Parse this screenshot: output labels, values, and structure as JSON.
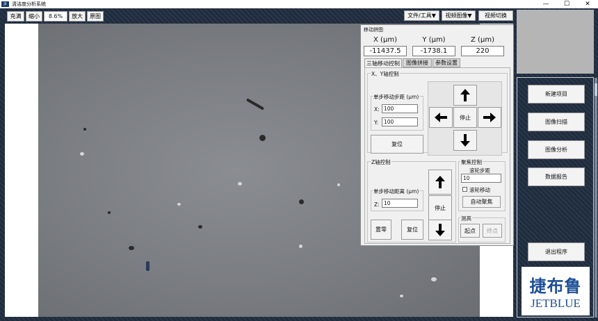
{
  "window": {
    "title": "清洁度分析系统",
    "icon": "app-logo-icon",
    "minimize": "—",
    "maximize": "☐",
    "close": "✕"
  },
  "toolbar": {
    "fit": "充满",
    "zoom_out": "缩小",
    "zoom_value": "8.6%",
    "zoom_in": "放大",
    "original": "原图",
    "file_tools": "文件/工具▼",
    "video_image": "视频图像▼",
    "video_switch": "视频切换"
  },
  "dialog": {
    "title": "移动拼图",
    "axes": [
      {
        "label": "X (μm)",
        "value": "-11437.5"
      },
      {
        "label": "Y (μm)",
        "value": "-1738.1"
      },
      {
        "label": "Z (μm)",
        "value": "220"
      }
    ],
    "tabs": [
      "三轴移动控制",
      "图像拼接",
      "参数设置"
    ],
    "xy": {
      "group": "X、Y轴控制",
      "step_group": "单步移动步距 (μm)",
      "x_label": "X:",
      "x_value": "100",
      "y_label": "Y:",
      "y_value": "100",
      "reset": "复位",
      "stop": "停止"
    },
    "z": {
      "group": "Z轴控制",
      "step_group": "单步移动距离 (μm)",
      "z_label": "Z:",
      "z_value": "10",
      "zero": "置零",
      "reset": "复位",
      "stop": "停止"
    },
    "focus": {
      "group": "聚焦控制",
      "wheel_step": "滚轮步距",
      "wheel_value": "10",
      "wheel_move": "滚轮移动",
      "auto_focus": "自动聚焦"
    },
    "height": {
      "group": "测高",
      "start": "起点",
      "end": "终点"
    }
  },
  "right_panel": {
    "new_project": "新建项目",
    "scan": "图像扫描",
    "analysis": "图像分析",
    "report": "数据报告",
    "exit": "退出程序"
  },
  "logo": {
    "cn": "捷布鲁",
    "en": "JETBLUE"
  }
}
